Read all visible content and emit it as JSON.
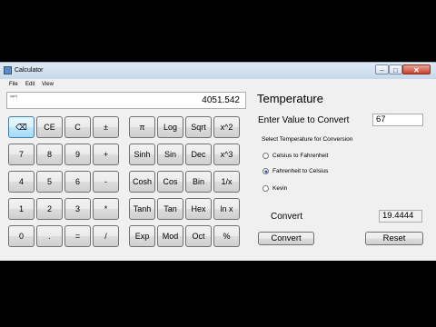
{
  "window": {
    "title": "Calculator"
  },
  "menu": [
    "File",
    "Edit",
    "View"
  ],
  "display": {
    "expression": "sqrt(",
    "result": "4051.542"
  },
  "keypad": {
    "basic": [
      [
        "⌫",
        "CE",
        "C",
        "±"
      ],
      [
        "7",
        "8",
        "9",
        "+"
      ],
      [
        "4",
        "5",
        "6",
        "-"
      ],
      [
        "1",
        "2",
        "3",
        "*"
      ],
      [
        "0",
        ".",
        "=",
        "/"
      ]
    ],
    "scientific": [
      [
        "π",
        "Log",
        "Sqrt",
        "x^2"
      ],
      [
        "Sinh",
        "Sin",
        "Dec",
        "x^3"
      ],
      [
        "Cosh",
        "Cos",
        "Bin",
        "1/x"
      ],
      [
        "Tanh",
        "Tan",
        "Hex",
        "ln x"
      ],
      [
        "Exp",
        "Mod",
        "Oct",
        "%"
      ]
    ]
  },
  "converter": {
    "heading": "Temperature",
    "enter_label": "Enter Value to Convert",
    "enter_value": "67",
    "select_label": "Select Temperature for Conversion",
    "options": [
      "Celsius to Fahrenheit",
      "Fahrenheit to Celsius",
      "Kevin"
    ],
    "selected_index": 1,
    "result_label": "Convert",
    "result_value": "19.4444",
    "convert_button": "Convert",
    "reset_button": "Reset"
  }
}
